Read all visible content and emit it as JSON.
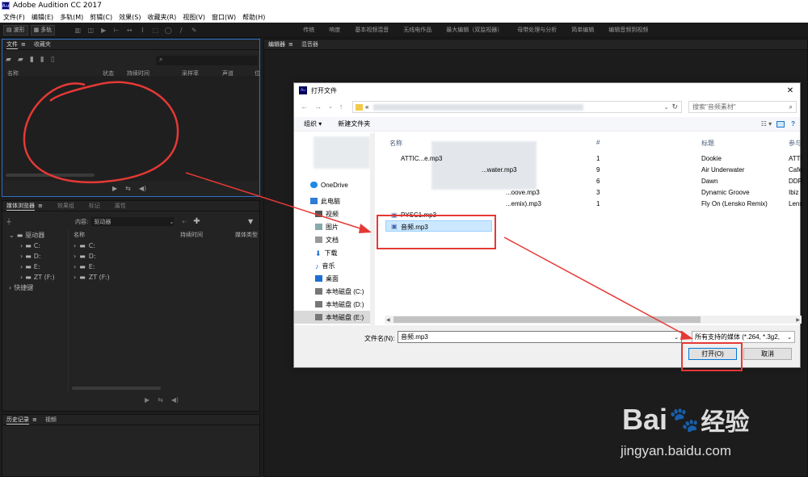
{
  "app": {
    "title": "Adobe Audition CC 2017",
    "logo": "Au",
    "menu": [
      "文件(F)",
      "编辑(E)",
      "多轨(M)",
      "剪辑(C)",
      "效果(S)",
      "收藏夹(R)",
      "视图(V)",
      "窗口(W)",
      "帮助(H)"
    ]
  },
  "toolbar": {
    "waveform_label": "波形",
    "multitrack_label": "多轨",
    "workspaces": [
      "传统",
      "响度",
      "基本视频混音",
      "无线电作品",
      "最大编辑（双监视器）",
      "母带处理与分析",
      "简单编辑",
      "编辑音频到视频"
    ]
  },
  "files_panel": {
    "tabs": [
      "文件",
      "收藏夹"
    ],
    "columns": [
      "名称",
      "状态",
      "持续时间",
      "采样率",
      "声道",
      "位"
    ]
  },
  "media_panel": {
    "tabs": [
      "媒体浏览器",
      "效果组",
      "标记",
      "属性"
    ],
    "content_label": "内容:",
    "content_value": "驱动器",
    "tree": [
      "驱动器",
      "C:",
      "D:",
      "E:",
      "ZT (F:)",
      "快捷键"
    ],
    "columns": [
      "名称",
      "持续时间",
      "媒体类型"
    ],
    "list": [
      "C:",
      "D:",
      "E:",
      "ZT (F:)"
    ]
  },
  "history_panel": {
    "tabs": [
      "历史记录",
      "视频"
    ]
  },
  "editor_panel": {
    "tabs": [
      "编辑器",
      "混音器"
    ]
  },
  "dialog": {
    "title": "打开文件",
    "logo": "Au",
    "address_prefix": "«",
    "search_placeholder": "搜索\"音频素材\"",
    "organize_label": "组织 ▾",
    "new_folder_label": "新建文件夹",
    "nav": [
      "OneDrive",
      "此电脑",
      "视频",
      "图片",
      "文档",
      "下载",
      "音乐",
      "桌面",
      "本地磁盘 (C:)",
      "本地磁盘 (D:)",
      "本地磁盘 (E:)"
    ],
    "columns": [
      "名称",
      "#",
      "标题",
      "参与"
    ],
    "files": [
      {
        "name": "ATTIC...e.mp3",
        "num": "1",
        "title": "Dookie",
        "artist": "ATTI"
      },
      {
        "name": "...water.mp3",
        "num": "9",
        "title": "Air Underwater",
        "artist": "Cafe"
      },
      {
        "name": "",
        "num": "6",
        "title": "Dawn",
        "artist": "DDR"
      },
      {
        "name": "...oove.mp3",
        "num": "3",
        "title": "Dynamic Groove",
        "artist": "Ibiz"
      },
      {
        "name": "...emix).mp3",
        "num": "1",
        "title": "Fly On (Lensko Remix)",
        "artist": "Lens"
      },
      {
        "name": "PYSC1.mp3",
        "num": "",
        "title": "",
        "artist": ""
      },
      {
        "name": "音频.mp3",
        "num": "",
        "title": "",
        "artist": ""
      }
    ],
    "filename_label": "文件名(N):",
    "filename_value": "音频.mp3",
    "filter_value": "所有支持的媒体 (*.264, *.3g2,",
    "open_label": "打开(O)",
    "cancel_label": "取消"
  },
  "watermark": {
    "brand": "Bai",
    "brand_cn": "经验",
    "url": "jingyan.baidu.com"
  },
  "colors": {
    "annotation": "#e53935",
    "selection": "#cce8ff",
    "accent": "#2d6fc4"
  }
}
